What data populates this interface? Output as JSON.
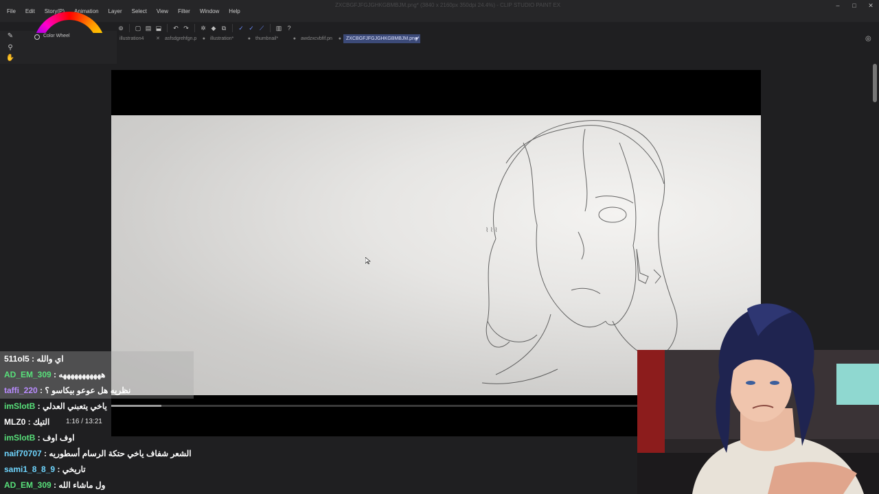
{
  "app": {
    "title": "ZXCBGFJFGJGHKGBMBJM.png* (3840 x 2160px 350dpi 24.4%) - CLIP STUDIO PAINT EX",
    "menu": [
      "File",
      "Edit",
      "Story(P)",
      "Animation",
      "Layer",
      "Select",
      "View",
      "Filter",
      "Window",
      "Help"
    ]
  },
  "left_panel": {
    "color_wheel_label": "Color Wheel"
  },
  "tabs": [
    {
      "label": "illustration4",
      "active": false
    },
    {
      "label": "asfsdgrehfgn.p",
      "active": false
    },
    {
      "label": "illustration*",
      "active": false
    },
    {
      "label": "thumbnail*",
      "active": false
    },
    {
      "label": "awdzxcvbfif.pn",
      "active": false
    },
    {
      "label": "ZXCBGFJFGJGHKGBMBJM.png*",
      "active": true
    }
  ],
  "video": {
    "time": "1:16 / 13:21",
    "progress": 0.095
  },
  "chat": [
    {
      "user": "511ol5",
      "color": "#ffffff",
      "message": "اي والله"
    },
    {
      "user": "AD_EM_309",
      "color": "#58e07a",
      "message": "هههههههههههه"
    },
    {
      "user": "taffi_220",
      "color": "#b98cff",
      "message": "نظريه هل عوعو بيكاسو ؟"
    },
    {
      "user": "imSlotB",
      "color": "#58e07a",
      "message": "ياخي يتعبني العدلي"
    },
    {
      "user": "MLZ0",
      "color": "#ffffff",
      "message": "التيك"
    },
    {
      "user": "imSlotB",
      "color": "#58e07a",
      "message": "اوف اوف"
    },
    {
      "user": "naif70707",
      "color": "#6fd6ff",
      "message": "الشعر شفاف ياخي حتكة الرسام أسطوريه"
    },
    {
      "user": "sami1_8_8_9",
      "color": "#6fd6ff",
      "message": "تاريخي"
    },
    {
      "user": "AD_EM_309",
      "color": "#58e07a",
      "message": "ول ماشاء الله"
    }
  ],
  "icons": {
    "toolbar": [
      "navigator-icon",
      "new-icon",
      "open-icon",
      "save-icon",
      "undo-icon",
      "redo-icon",
      "settings-icon",
      "fill-icon",
      "transform-icon",
      "pen-icon",
      "stroke-icon",
      "line-icon",
      "layer-icon",
      "help-icon"
    ],
    "left_tools": [
      "brush-icon",
      "search-icon",
      "hand-icon"
    ]
  }
}
